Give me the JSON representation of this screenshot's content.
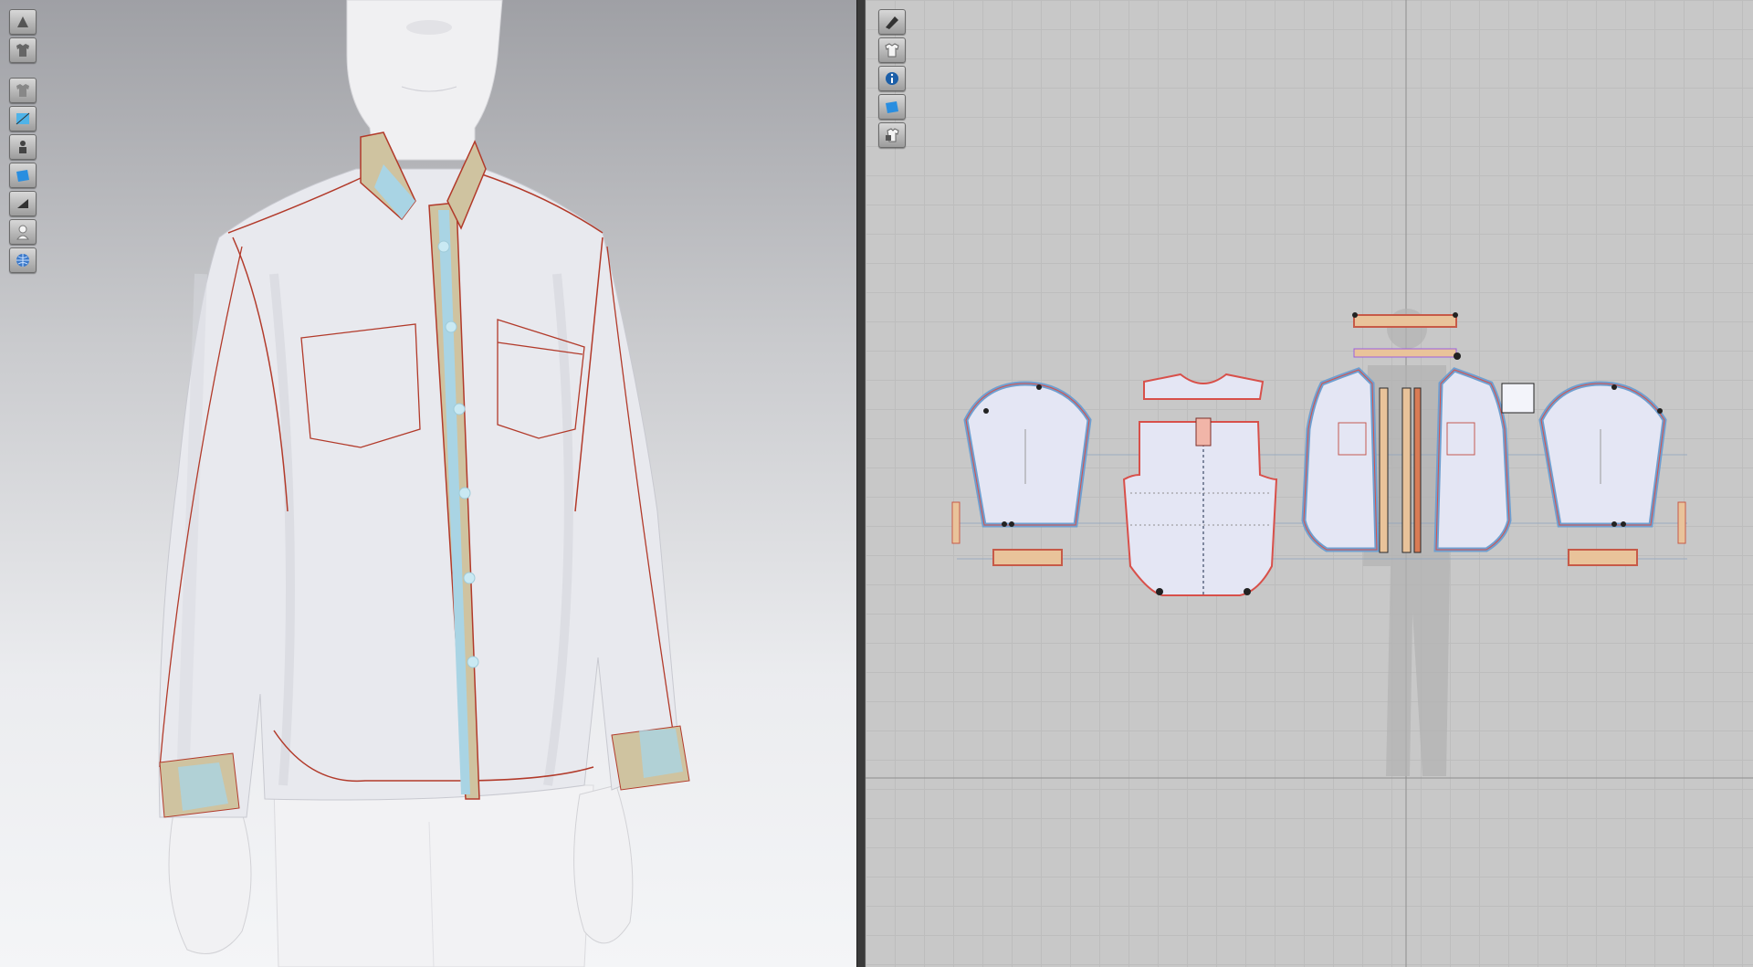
{
  "colors": {
    "shirt": "#e8e9ee",
    "seam": "#b23a2a",
    "placket": "#cfc3a0",
    "fusing": "#a9d4e4",
    "pattern_fill": "#e4e6f4",
    "pattern_outline": "#d8504a",
    "pattern_edge_blue": "#6f9fd0",
    "avatar": "#f0f0f2"
  },
  "toolbar_3d": {
    "icons": [
      "show-avatar-icon",
      "show-garment-icon",
      "avatar-shaded-icon",
      "garment-texture-icon",
      "avatar-solid-icon",
      "fabric-blue-icon",
      "garment-dark-icon",
      "avatar-silhouette-icon",
      "globe-grid-icon"
    ]
  },
  "toolbar_2d": {
    "icons": [
      "show-pattern-icon",
      "show-shirt-icon",
      "info-icon",
      "fabric-blue-icon",
      "lock-shirt-icon"
    ]
  }
}
